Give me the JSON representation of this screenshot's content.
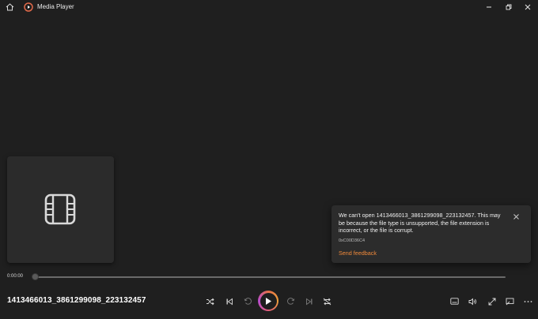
{
  "app": {
    "title": "Media Player"
  },
  "window": {
    "minimize": "–",
    "maximize": "⧉",
    "close": "✕"
  },
  "error": {
    "message": "We can't open 1413466013_3861299098_223132457. This may be because the file type is unsupported, the file extension is incorrect, or the file is corrupt.",
    "code": "0xC00D36C4",
    "feedback_link": "Send feedback"
  },
  "player": {
    "current_time": "0:00:00",
    "progress": 0,
    "now_playing": "1413466013_3861299098_223132457"
  },
  "colors": {
    "accent_link": "#f0893a",
    "background": "#1f1f1f"
  },
  "icons": {
    "home": "home-icon",
    "logo": "media-player-logo",
    "shuffle": "shuffle-icon",
    "previous": "previous-icon",
    "rewind": "skip-back-10-icon",
    "play": "play-icon",
    "forward": "skip-forward-30-icon",
    "next": "next-icon",
    "repeat": "repeat-icon",
    "miniplayer": "mini-player-icon",
    "volume": "volume-icon",
    "fullscreen": "fullscreen-icon",
    "cast": "cast-icon",
    "more": "more-icon"
  }
}
